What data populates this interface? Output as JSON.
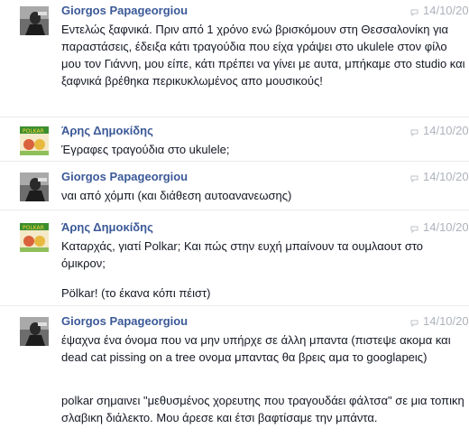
{
  "messages": [
    {
      "sender": "Giorgos Papageorgiou",
      "time": "14/10/20",
      "avatar": "photo-avatar-person",
      "paragraphs": [
        "Εντελώς ξαφνικά. Πριν από 1 χρόνο ενώ βρισκόμουν στη Θεσσαλονίκη για παραστάσεις, έδειξα κάτι τραγούδια που είχα γράψει στο ukulele στον φίλο μου τον Γιάννη, μου είπε, κάτι πρέπει να γίνει με αυτα, μπήκαμε στο studio και ξαφνικά βρέθηκα περικυκλωμένος απο μουσικούς!"
      ]
    },
    {
      "sender": "Άρης Δημοκίδης",
      "time": "14/10/20",
      "avatar": "polkar-cartoon-avatar",
      "paragraphs": [
        "Έγραφες τραγούδια στο ukulele;"
      ]
    },
    {
      "sender": "Giorgos Papageorgiou",
      "time": "14/10/20",
      "avatar": "photo-avatar-person",
      "paragraphs": [
        "ναι από χόμπι (και διάθεση αυτοανανεωσης)"
      ]
    },
    {
      "sender": "Άρης Δημοκίδης",
      "time": "14/10/20",
      "avatar": "polkar-cartoon-avatar",
      "paragraphs": [
        "Καταρχάς, γιατί Polkar; Και πώς στην ευχή μπαίνουν τα ουμλαουτ στο όμικρον;",
        "Pölkar! (το έκανα κόπι πέιστ)"
      ]
    },
    {
      "sender": "Giorgos Papageorgiou",
      "time": "14/10/20",
      "avatar": "photo-avatar-person",
      "paragraphs": [
        "έψαχνα ένα όνομα που να μην υπήρχε σε άλλη μπαντα (πιστεψε ακομα και dead cat pissing on a tree ονομα μπαντας θα βρεις αμα το googlapeις)",
        "polkar σημαινει \"μεθυσμένος χορευτης που τραγουδάει φάλτσα\" σε μια τοπικη σλαβικη διάλεκτο. Μου άρεσε και έτσι βαφτίσαμε την μπάντα."
      ]
    }
  ]
}
